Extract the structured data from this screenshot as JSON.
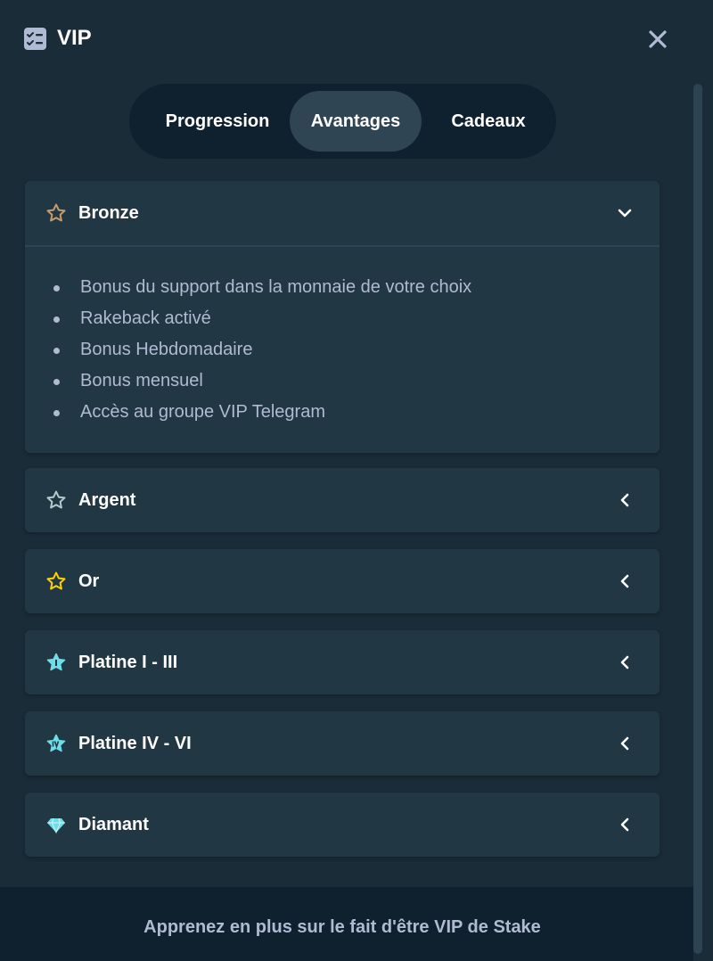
{
  "header": {
    "title": "VIP",
    "icon": "vip-checklist-icon",
    "close_icon": "close-icon"
  },
  "tabs": [
    {
      "label": "Progression",
      "active": false
    },
    {
      "label": "Avantages",
      "active": true
    },
    {
      "label": "Cadeaux",
      "active": false
    }
  ],
  "tiers": [
    {
      "name": "Bronze",
      "icon": "bronze-star-icon",
      "color": "#c69c6d",
      "expanded": true,
      "benefits": [
        "Bonus du support dans la monnaie de votre choix",
        "Rakeback activé",
        "Bonus Hebdomadaire",
        "Bonus mensuel",
        "Accès au groupe VIP Telegram"
      ]
    },
    {
      "name": "Argent",
      "icon": "silver-star-icon",
      "color": "#b2cccc",
      "expanded": false
    },
    {
      "name": "Or",
      "icon": "gold-star-icon",
      "color": "#fed100",
      "expanded": false
    },
    {
      "name": "Platine I - III",
      "icon": "platinum-star-icon",
      "color": "#6fdde7",
      "expanded": false
    },
    {
      "name": "Platine IV - VI",
      "icon": "platinum-star-icon",
      "color": "#6fdde7",
      "expanded": false
    },
    {
      "name": "Diamant",
      "icon": "diamond-icon",
      "color": "#6fdde7",
      "expanded": false
    }
  ],
  "footer": {
    "link": "Apprenez en plus sur le fait d'être VIP de Stake"
  },
  "colors": {
    "background": "#1a2c38",
    "panel": "#213743",
    "tab_active": "#2f4553",
    "tab_bar": "#0f212e",
    "text_primary": "#ffffff",
    "text_secondary": "#b1bad3"
  }
}
